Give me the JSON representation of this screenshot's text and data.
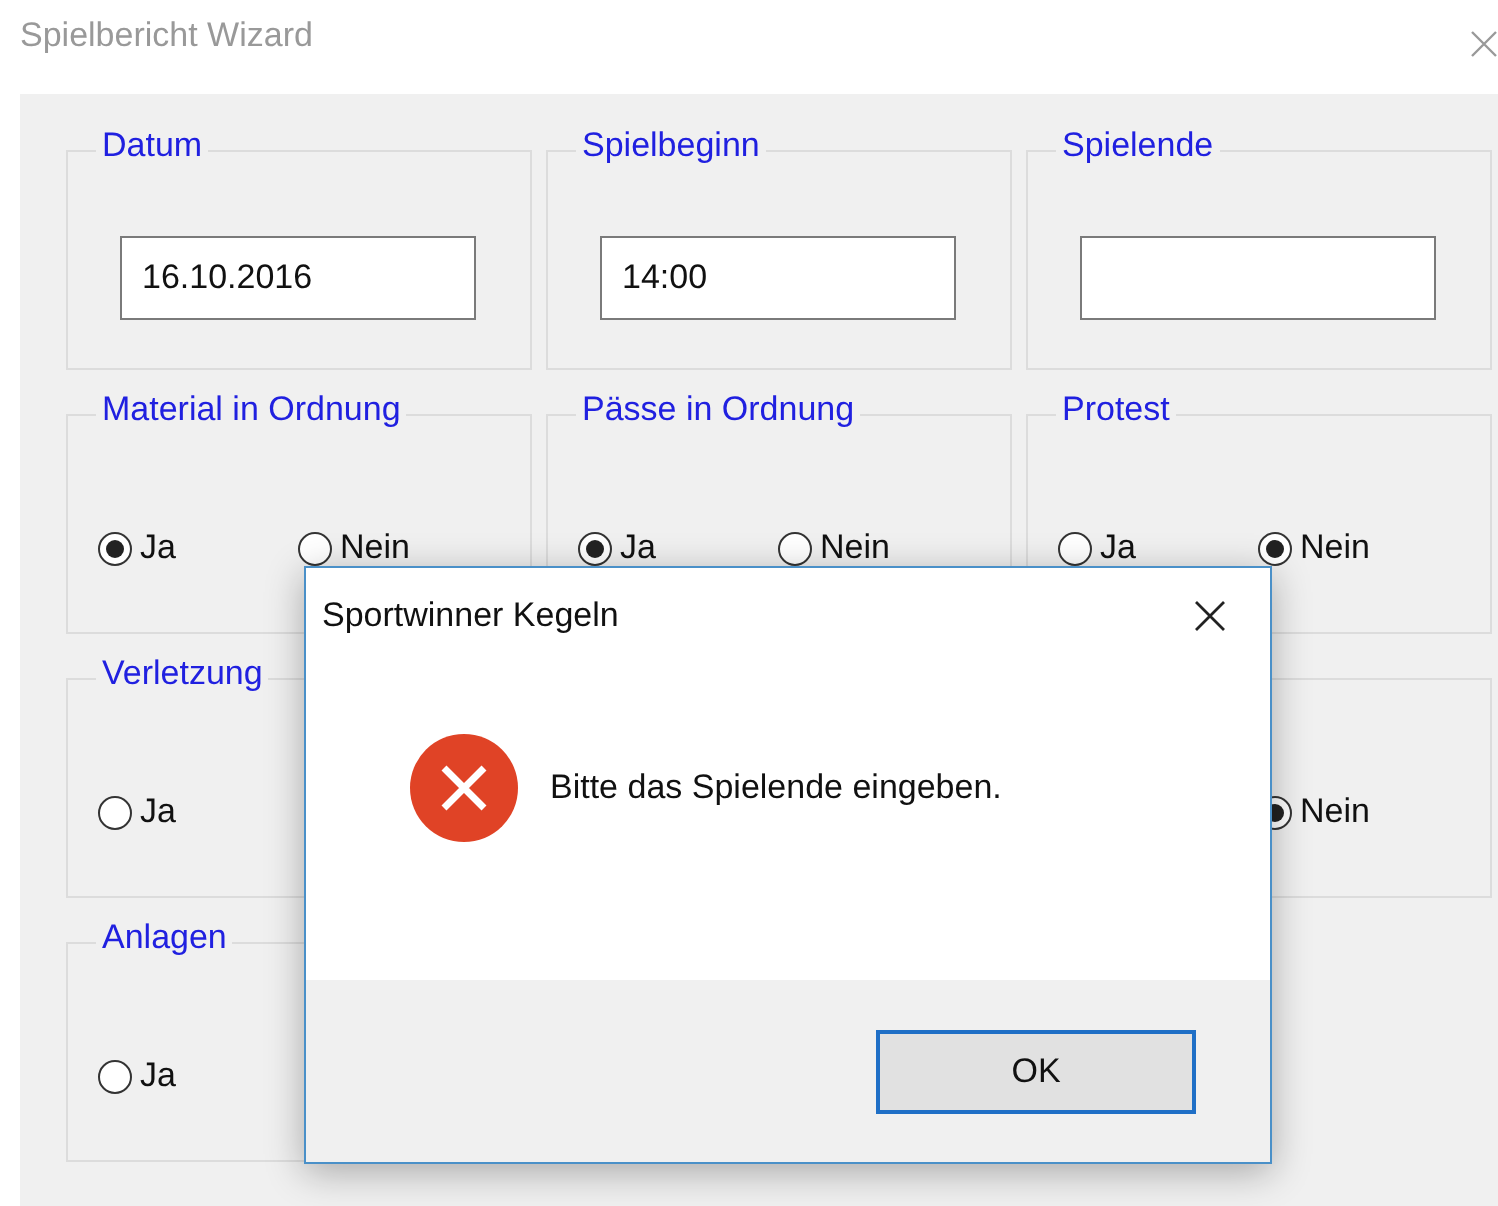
{
  "window": {
    "title": "Spielbericht Wizard"
  },
  "field_groups": [
    {
      "title": "Datum",
      "value": "16.10.2016"
    },
    {
      "title": "Spielbeginn",
      "value": "14:00"
    },
    {
      "title": "Spielende"
    }
  ],
  "radio_rows": [
    {
      "groups": [
        {
          "title": "Material in Ordnung",
          "options": [
            {
              "kind": "ja",
              "label": "Ja",
              "selected": true
            },
            {
              "kind": "nein",
              "label": "Nein",
              "selected": false
            }
          ]
        },
        {
          "title": "Pässe in Ordnung",
          "options": [
            {
              "kind": "ja",
              "label": "Ja",
              "selected": true
            },
            {
              "kind": "nein",
              "label": "Nein",
              "selected": false
            }
          ]
        },
        {
          "title": "Protest",
          "options": [
            {
              "kind": "ja",
              "label": "Ja",
              "selected": false
            },
            {
              "kind": "nein",
              "label": "Nein",
              "selected": true
            }
          ]
        }
      ]
    },
    {
      "groups": [
        {
          "title": "Verletzung",
          "options": [
            {
              "kind": "ja",
              "label": "Ja",
              "selected": false
            }
          ]
        },
        {
          "options": [
            {
              "kind": "nein",
              "label": "Nein",
              "selected": true
            }
          ]
        }
      ]
    },
    {
      "groups": [
        {
          "title": "Anlagen",
          "options": [
            {
              "kind": "ja",
              "label": "Ja",
              "selected": false
            }
          ]
        }
      ]
    }
  ],
  "dialog": {
    "title": "Sportwinner Kegeln",
    "message": "Bitte das Spielende eingeben.",
    "buttons": [
      "OK"
    ]
  }
}
